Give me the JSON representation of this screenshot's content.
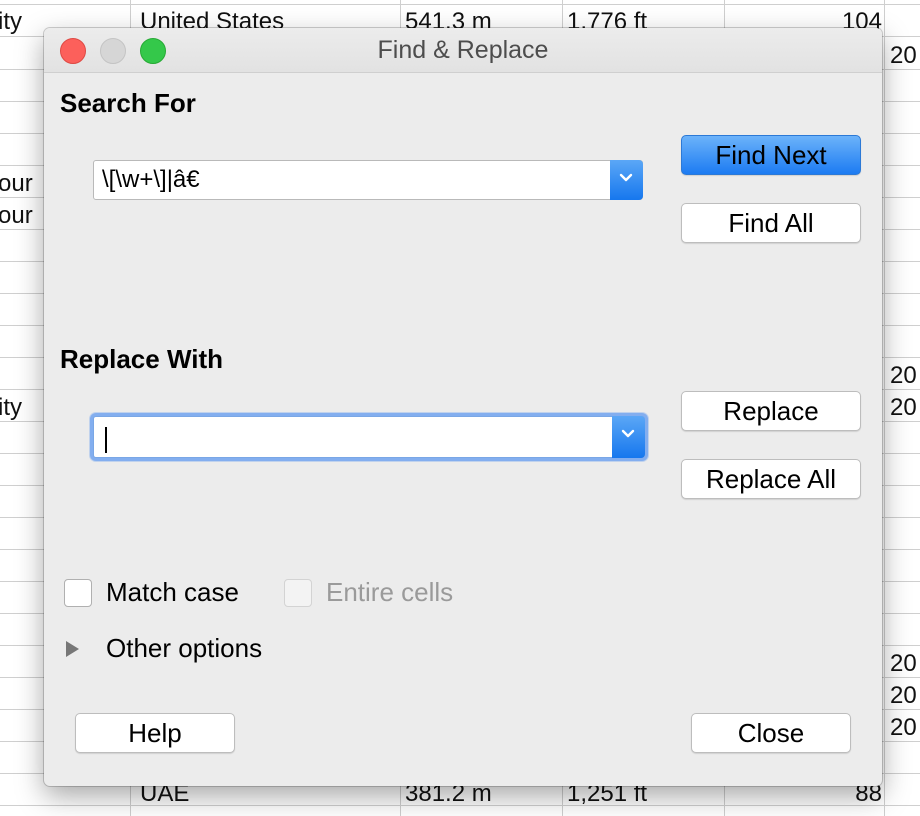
{
  "dialog": {
    "title": "Find & Replace",
    "search_label": "Search For",
    "search_value": "\\[\\w+\\]|â€",
    "replace_label": "Replace With",
    "replace_value": "",
    "buttons": {
      "find_next": "Find Next",
      "find_all": "Find All",
      "replace": "Replace",
      "replace_all": "Replace All",
      "help": "Help",
      "close": "Close"
    },
    "options": {
      "match_case": "Match case",
      "entire_cells": "Entire cells",
      "other_options": "Other options"
    }
  },
  "sheet": {
    "top_row": [
      "United States",
      "541.3 m",
      "1,776 ft",
      "104"
    ],
    "bottom_row": [
      "UAE",
      "381.2 m",
      "1,251 ft",
      "88"
    ],
    "left_fragments": [
      "ity",
      "our",
      "our",
      "ity"
    ],
    "right_fragments": [
      "20",
      "20",
      "20",
      "20",
      "20",
      "20"
    ]
  },
  "icons": {
    "dropdown": "chevron-down-icon",
    "disclosure": "disclosure-triangle-icon"
  },
  "colors": {
    "accent": "#1c7bf2",
    "close": "#fc605b",
    "maximize": "#34c84a"
  }
}
